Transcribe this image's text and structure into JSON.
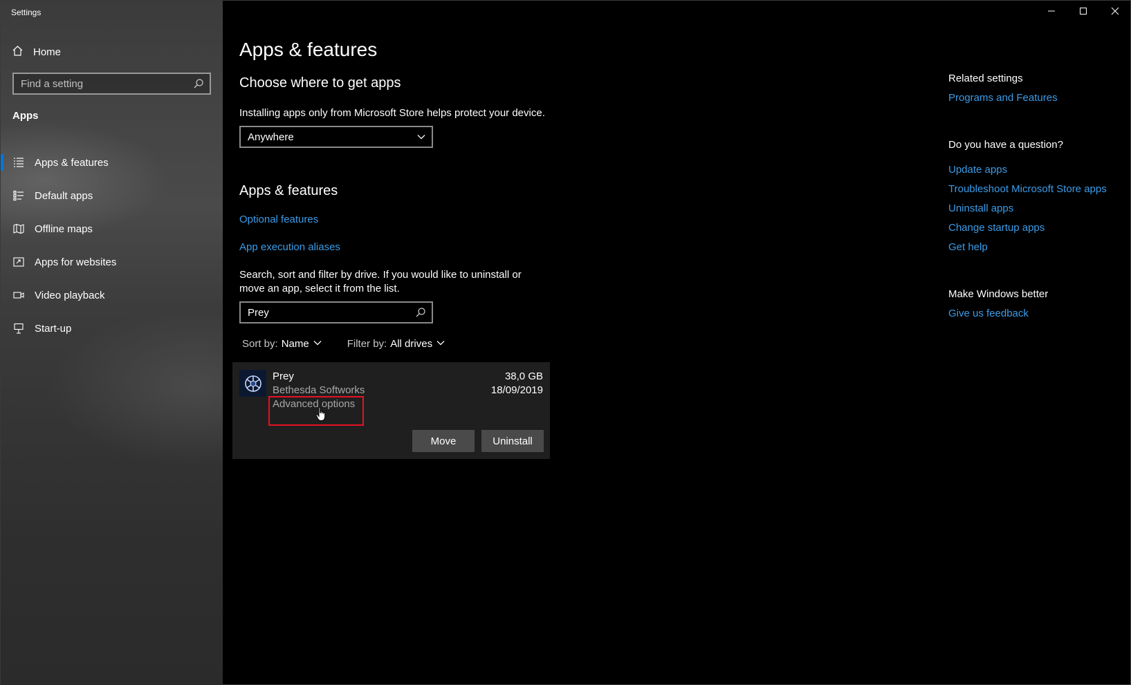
{
  "window": {
    "title": "Settings"
  },
  "sidebar": {
    "home_label": "Home",
    "search_placeholder": "Find a setting",
    "section": "Apps",
    "items": [
      {
        "label": "Apps & features",
        "icon": "list-icon",
        "active": true
      },
      {
        "label": "Default apps",
        "icon": "default-apps-icon",
        "active": false
      },
      {
        "label": "Offline maps",
        "icon": "map-icon",
        "active": false
      },
      {
        "label": "Apps for websites",
        "icon": "web-app-icon",
        "active": false
      },
      {
        "label": "Video playback",
        "icon": "video-icon",
        "active": false
      },
      {
        "label": "Start-up",
        "icon": "startup-icon",
        "active": false
      }
    ]
  },
  "main": {
    "title": "Apps & features",
    "choose_heading": "Choose where to get apps",
    "choose_desc": "Installing apps only from Microsoft Store helps protect your device.",
    "source_dropdown_value": "Anywhere",
    "apps_heading": "Apps & features",
    "optional_features": "Optional features",
    "execution_aliases": "App execution aliases",
    "search_desc": "Search, sort and filter by drive. If you would like to uninstall or move an app, select it from the list.",
    "search_value": "Prey",
    "sort_label": "Sort by:",
    "sort_value": "Name",
    "filter_label": "Filter by:",
    "filter_value": "All drives",
    "app": {
      "name": "Prey",
      "publisher": "Bethesda Softworks",
      "advanced": "Advanced options",
      "size": "38,0 GB",
      "date": "18/09/2019",
      "move_label": "Move",
      "uninstall_label": "Uninstall"
    }
  },
  "related": {
    "related_heading": "Related settings",
    "programs_link": "Programs and Features",
    "question_heading": "Do you have a question?",
    "question_links": [
      "Update apps",
      "Troubleshoot Microsoft Store apps",
      "Uninstall apps",
      "Change startup apps",
      "Get help"
    ],
    "better_heading": "Make Windows better",
    "feedback_link": "Give us feedback"
  },
  "colors": {
    "accent": "#0078d7",
    "link": "#3b9ce8",
    "highlight": "#e81123"
  }
}
